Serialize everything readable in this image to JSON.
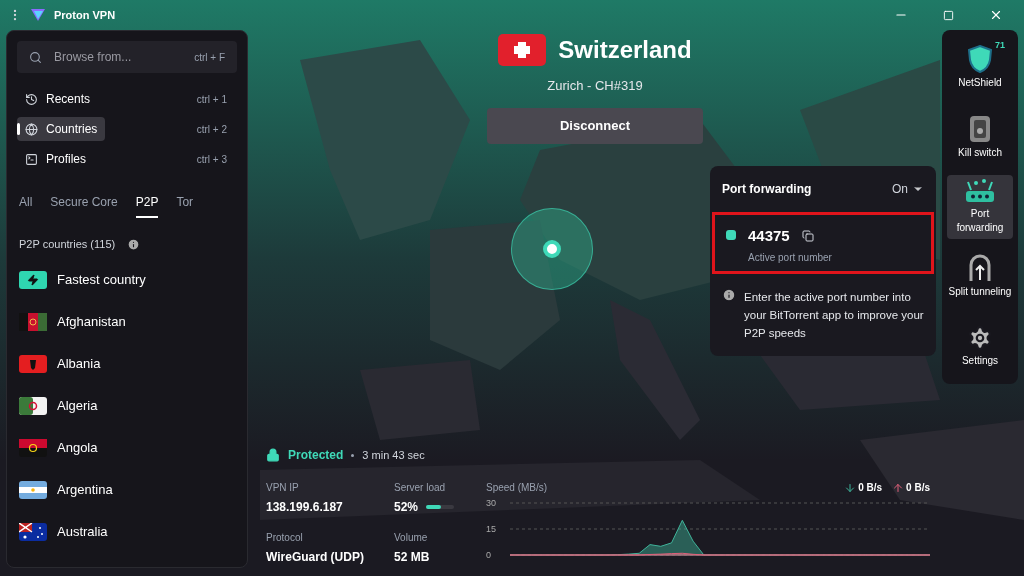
{
  "window": {
    "title": "Proton VPN"
  },
  "search": {
    "placeholder": "Browse from...",
    "shortcut": "ctrl + F"
  },
  "nav": [
    {
      "label": "Recents",
      "shortcut": "ctrl + 1",
      "selected": false
    },
    {
      "label": "Countries",
      "shortcut": "ctrl + 2",
      "selected": true
    },
    {
      "label": "Profiles",
      "shortcut": "ctrl + 3",
      "selected": false
    }
  ],
  "filter_tabs": [
    {
      "label": "All",
      "selected": false
    },
    {
      "label": "Secure Core",
      "selected": false
    },
    {
      "label": "P2P",
      "selected": true
    },
    {
      "label": "Tor",
      "selected": false
    }
  ],
  "list_heading": "P2P countries (115)",
  "countries": [
    {
      "kind": "fastest",
      "name": "Fastest country"
    },
    {
      "kind": "country",
      "name": "Afghanistan"
    },
    {
      "kind": "country",
      "name": "Albania"
    },
    {
      "kind": "country",
      "name": "Algeria"
    },
    {
      "kind": "country",
      "name": "Angola"
    },
    {
      "kind": "country",
      "name": "Argentina"
    },
    {
      "kind": "country",
      "name": "Australia"
    }
  ],
  "connection": {
    "country": "Switzerland",
    "server": "Zurich - CH#319",
    "button": "Disconnect"
  },
  "port_forwarding": {
    "title": "Port forwarding",
    "state": "On",
    "port": "44375",
    "port_label": "Active port number",
    "active": true,
    "info": "Enter the active port number into your BitTorrent app to improve your P2P speeds"
  },
  "status": {
    "label": "Protected",
    "duration": "3 min 43 sec"
  },
  "stats": [
    {
      "label": "VPN IP",
      "value": "138.199.6.187"
    },
    {
      "label": "Server load",
      "value": "52%",
      "level": 0.52
    },
    {
      "label": "Protocol",
      "value": "WireGuard (UDP)"
    },
    {
      "label": "Volume",
      "value": "52 MB"
    }
  ],
  "speed": {
    "download": "0 B/s",
    "upload": "0 B/s",
    "chart_data": {
      "type": "area",
      "ylabel": "Speed (MB/s)",
      "ylim": [
        0,
        30
      ],
      "yticks": [
        0,
        15,
        30
      ],
      "series": [
        {
          "color": "#3fb39a",
          "values": [
            0,
            0,
            0,
            0,
            0,
            0,
            0,
            0,
            0,
            0,
            0.2,
            0.5,
            1,
            6,
            5,
            7,
            20,
            8,
            0,
            0,
            0,
            0,
            0,
            0,
            0,
            0,
            0,
            0,
            0,
            0,
            0,
            0,
            0,
            0,
            0,
            0,
            0,
            0,
            0,
            0
          ]
        },
        {
          "color": "#e0607a",
          "values": [
            0,
            0,
            0,
            0,
            0,
            0,
            0,
            0,
            0,
            0,
            0,
            0,
            0,
            0.3,
            0.5,
            0.8,
            1,
            0.4,
            0,
            0,
            0,
            0,
            0,
            0,
            0,
            0,
            0,
            0,
            0,
            0,
            0,
            0,
            0,
            0,
            0,
            0,
            0,
            0,
            0,
            0
          ]
        }
      ]
    }
  },
  "rail": [
    {
      "kind": "netshield",
      "label": "NetShield",
      "badge": "71",
      "selected": false
    },
    {
      "kind": "killswitch",
      "label": "Kill switch",
      "selected": false
    },
    {
      "kind": "port",
      "label": "Port forwarding",
      "selected": true
    },
    {
      "kind": "split",
      "label": "Split tunneling",
      "selected": false
    },
    {
      "kind": "settings",
      "label": "Settings",
      "selected": false
    }
  ]
}
